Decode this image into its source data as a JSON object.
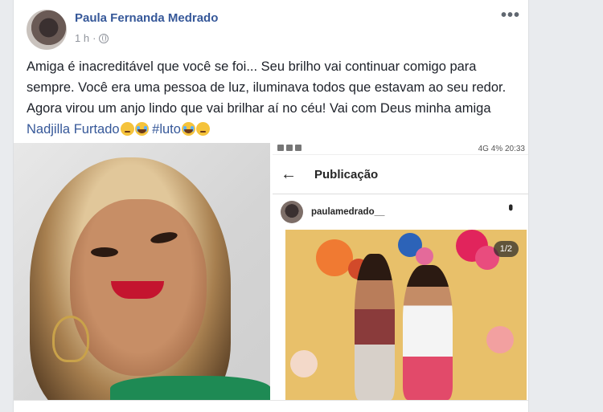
{
  "post": {
    "author": "Paula Fernanda Medrado",
    "time": "1 h",
    "separator": "·",
    "more_label": "•••",
    "text_main": "Amiga é inacreditável que você se foi... Seu brilho vai continuar comigo para sempre. Você era uma pessoa de luz, iluminava todos que estavam ao seu redor. Agora virou um anjo lindo que vai brilhar aí no céu! Vai com Deus minha amiga ",
    "tagged_friend": "Nadjilla Furtado",
    "hashtag": "#luto"
  },
  "screenshot": {
    "status_right": "4% 20:33",
    "status_signal": "4G",
    "back_icon": "←",
    "title": "Publicação",
    "username": "paulamedrado__",
    "counter": "1/2"
  },
  "colors": {
    "link": "#365899",
    "text": "#1d2129",
    "meta": "#90949c"
  }
}
